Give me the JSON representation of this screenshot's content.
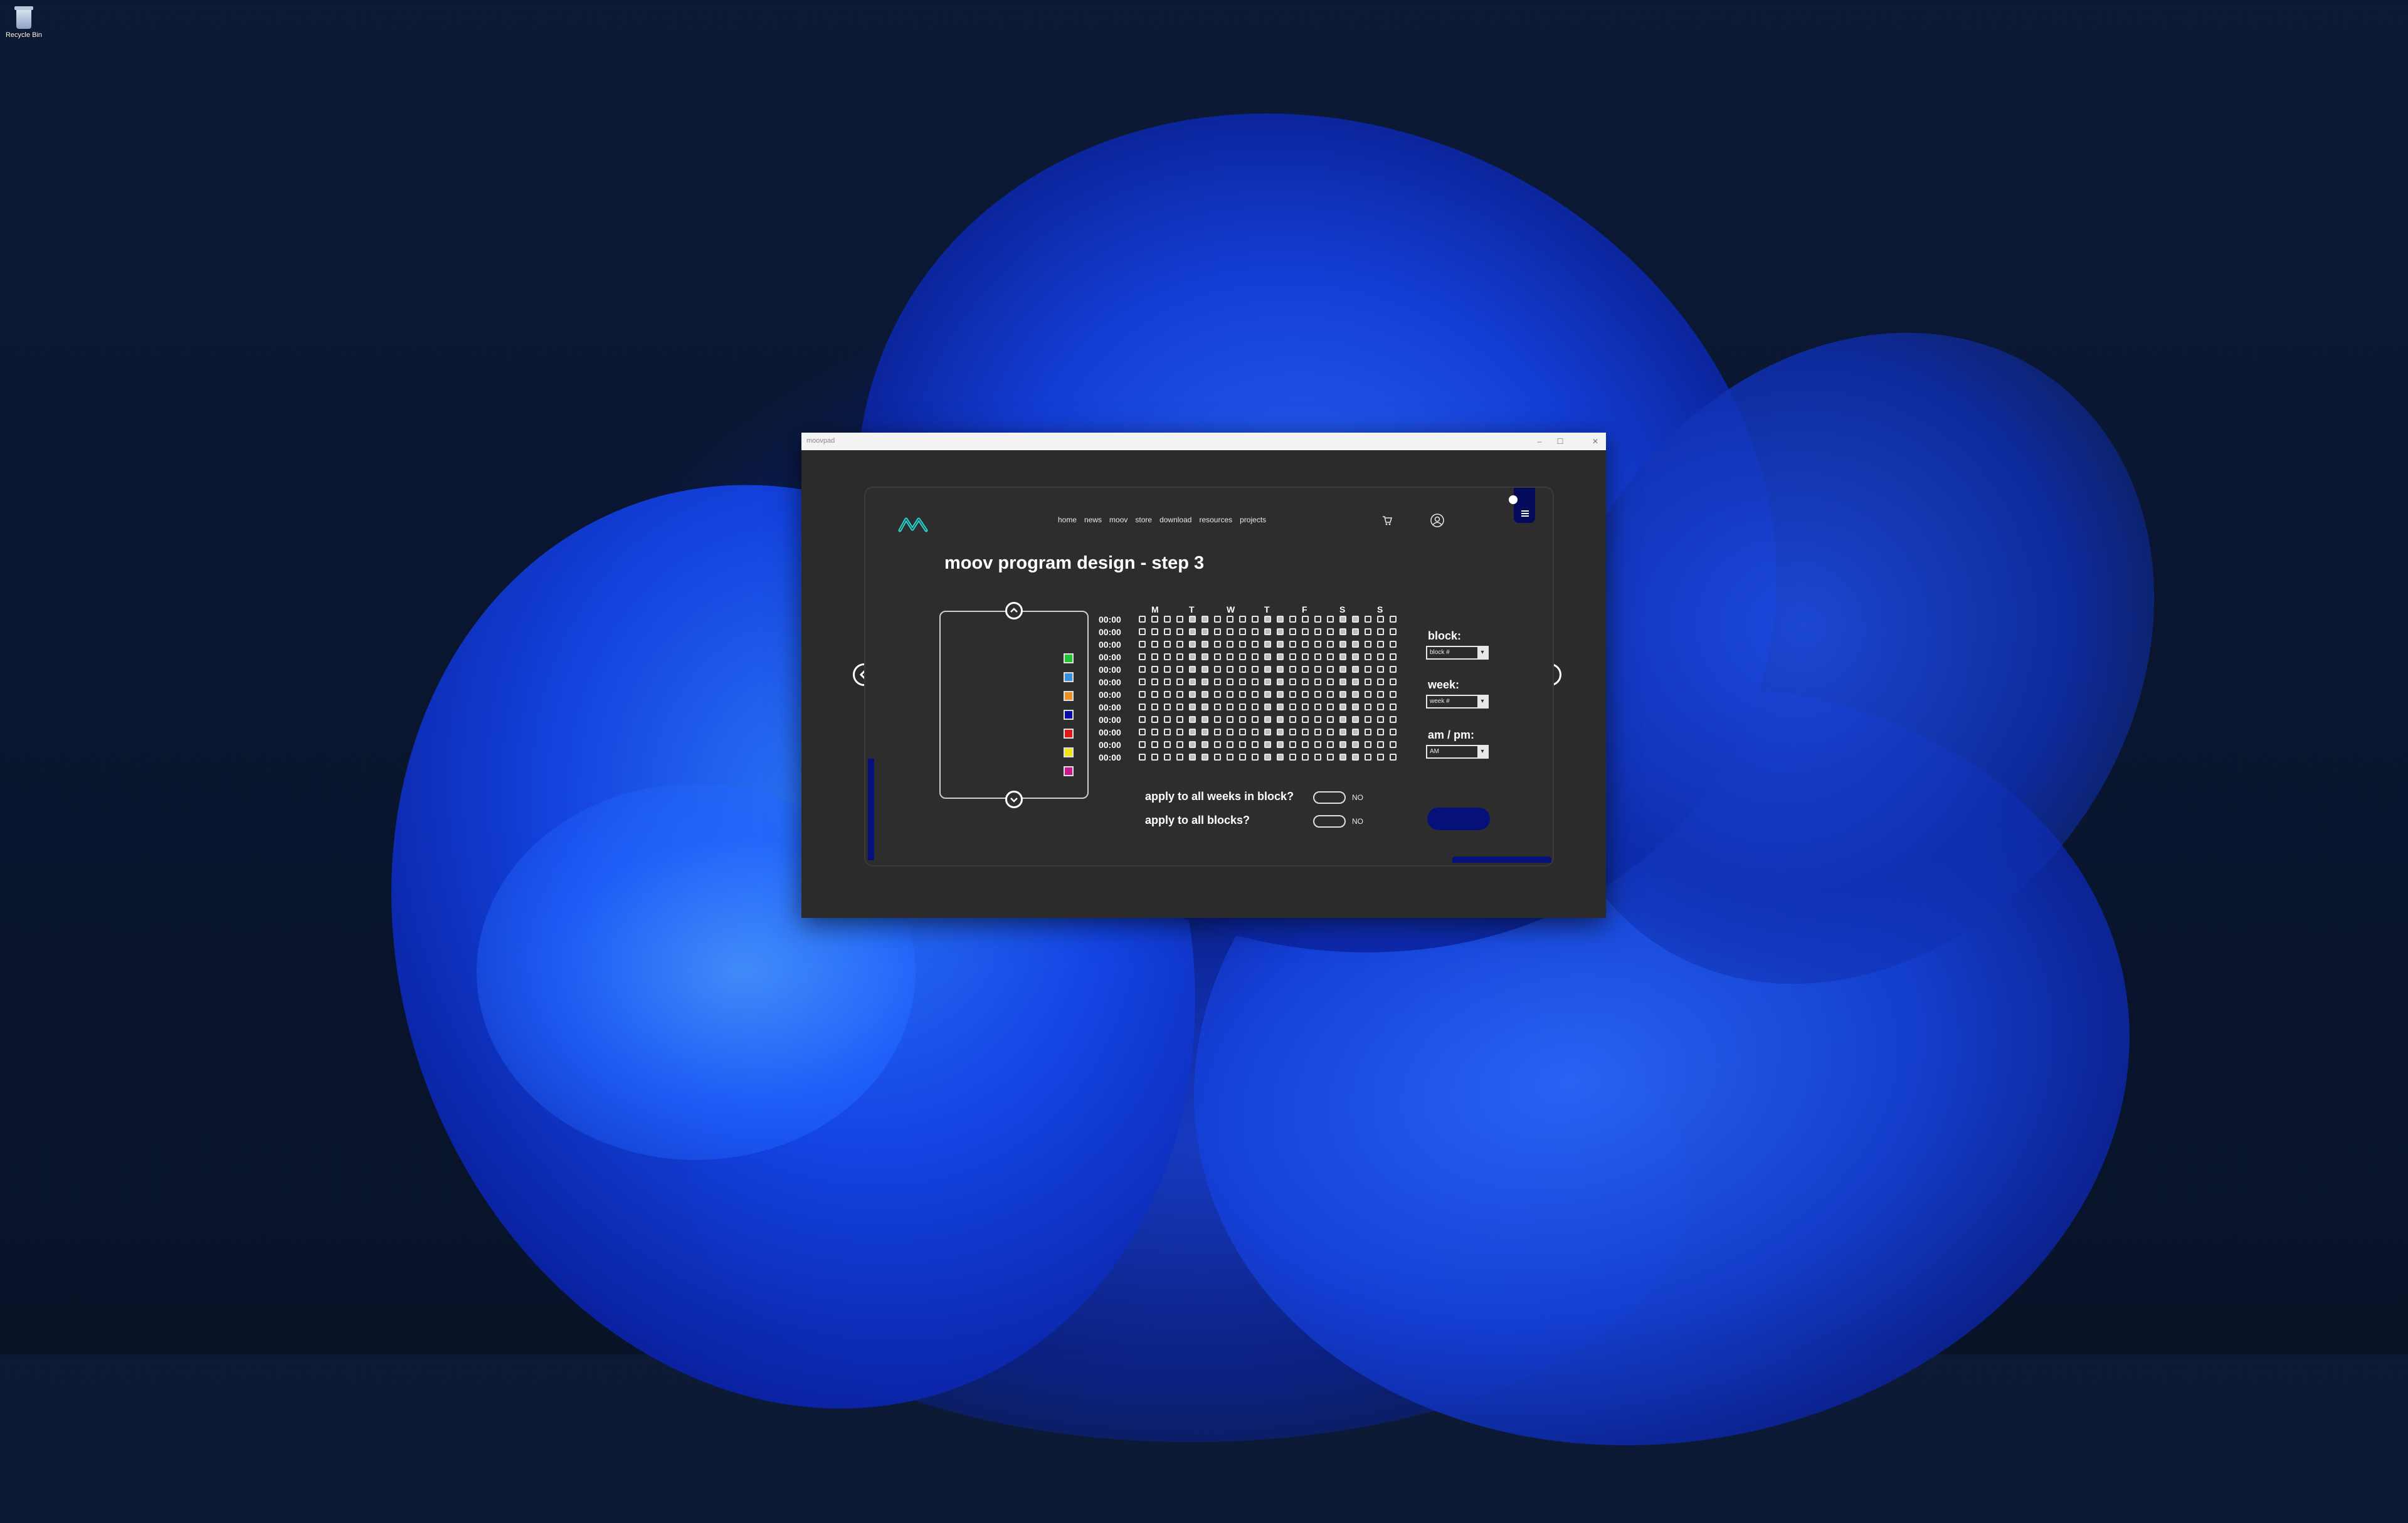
{
  "desktop": {
    "icon_label": "Recycle Bin"
  },
  "window": {
    "title": "moovpad",
    "controls": [
      "–",
      "☐",
      "✕"
    ]
  },
  "nav": {
    "items": [
      "home",
      "news",
      "moov",
      "store",
      "download",
      "resources",
      "projects"
    ]
  },
  "page": {
    "title": "moov program design - step 3"
  },
  "palette": {
    "colors": [
      "#22c232",
      "#3a8fd8",
      "#e8902a",
      "#0a0aa0",
      "#e01818",
      "#f2e21a",
      "#c41a8c"
    ]
  },
  "schedule": {
    "days": [
      "M",
      "T",
      "W",
      "T",
      "F",
      "S",
      "S"
    ],
    "times": [
      "00:00",
      "00:00",
      "00:00",
      "00:00",
      "00:00",
      "00:00",
      "00:00",
      "00:00",
      "00:00",
      "00:00",
      "00:00",
      "00:00"
    ],
    "cols_per_day": 3,
    "filled_columns": [
      4,
      5,
      10,
      11,
      16,
      17
    ]
  },
  "controls": {
    "block_label": "block:",
    "block_value": "block #",
    "week_label": "week:",
    "week_value": "week #",
    "ampm_label": "am / pm:",
    "ampm_value": "AM",
    "dropdown_glyph": "▾"
  },
  "questions": {
    "weeks": {
      "label": "apply to all weeks in block?",
      "value": "NO"
    },
    "blocks": {
      "label": "apply to all blocks?",
      "value": "NO"
    }
  },
  "colors": {
    "accent": "#05107a",
    "logo": "#33d6cf"
  }
}
